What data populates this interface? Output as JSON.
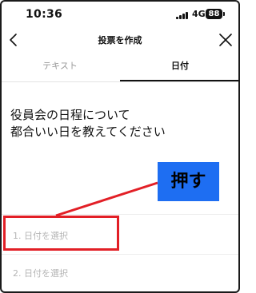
{
  "status_bar": {
    "time": "10:36",
    "network": "4G",
    "battery": "88"
  },
  "nav": {
    "title": "投票を作成"
  },
  "tabs": [
    {
      "label": "テキスト"
    },
    {
      "label": "日付"
    }
  ],
  "question": {
    "line1": "役員会の日程について",
    "line2": "都合いい日を教えてください"
  },
  "options": [
    {
      "label": "1.  日付を選択"
    },
    {
      "label": "2.  日付を選択"
    }
  ],
  "annotation": {
    "label": "押す",
    "badge_color": "#1e6ef2",
    "highlight_color": "#e21f26"
  }
}
